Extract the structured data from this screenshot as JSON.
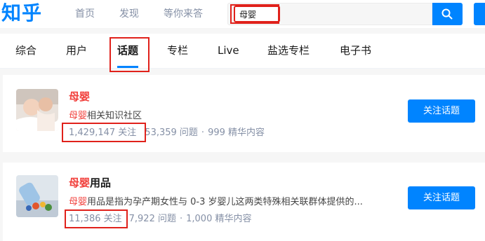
{
  "header": {
    "logo": "知乎",
    "nav": [
      "首页",
      "发现",
      "等你来答"
    ],
    "search_value": "母婴",
    "search_icon": "search-icon",
    "accent": "#0084ff"
  },
  "tabs": [
    "综合",
    "用户",
    "话题",
    "专栏",
    "Live",
    "盐选专栏",
    "电子书"
  ],
  "active_tab": "话题",
  "results": [
    {
      "title_highlight": "母婴",
      "title_rest": "",
      "desc_highlight": "母婴",
      "desc_rest": "相关知识社区",
      "followers": "1,429,147 关注",
      "questions": "53,359 问题",
      "featured": "999 精华内容",
      "separator": "·",
      "follow_label": "关注话题"
    },
    {
      "title_highlight": "母婴",
      "title_rest": "用品",
      "desc_highlight": "母婴",
      "desc_rest": "用品是指为孕产期女性与 0-3 岁婴儿这两类特殊相关联群体提供的...",
      "followers": "11,386 关注",
      "questions": "7,922 问题",
      "featured": "1,000 精华内容",
      "separator": "·",
      "follow_label": "关注话题"
    }
  ],
  "colors": {
    "accent": "#0084ff",
    "keyword": "#f1403c",
    "annotation": "#e0211b"
  }
}
